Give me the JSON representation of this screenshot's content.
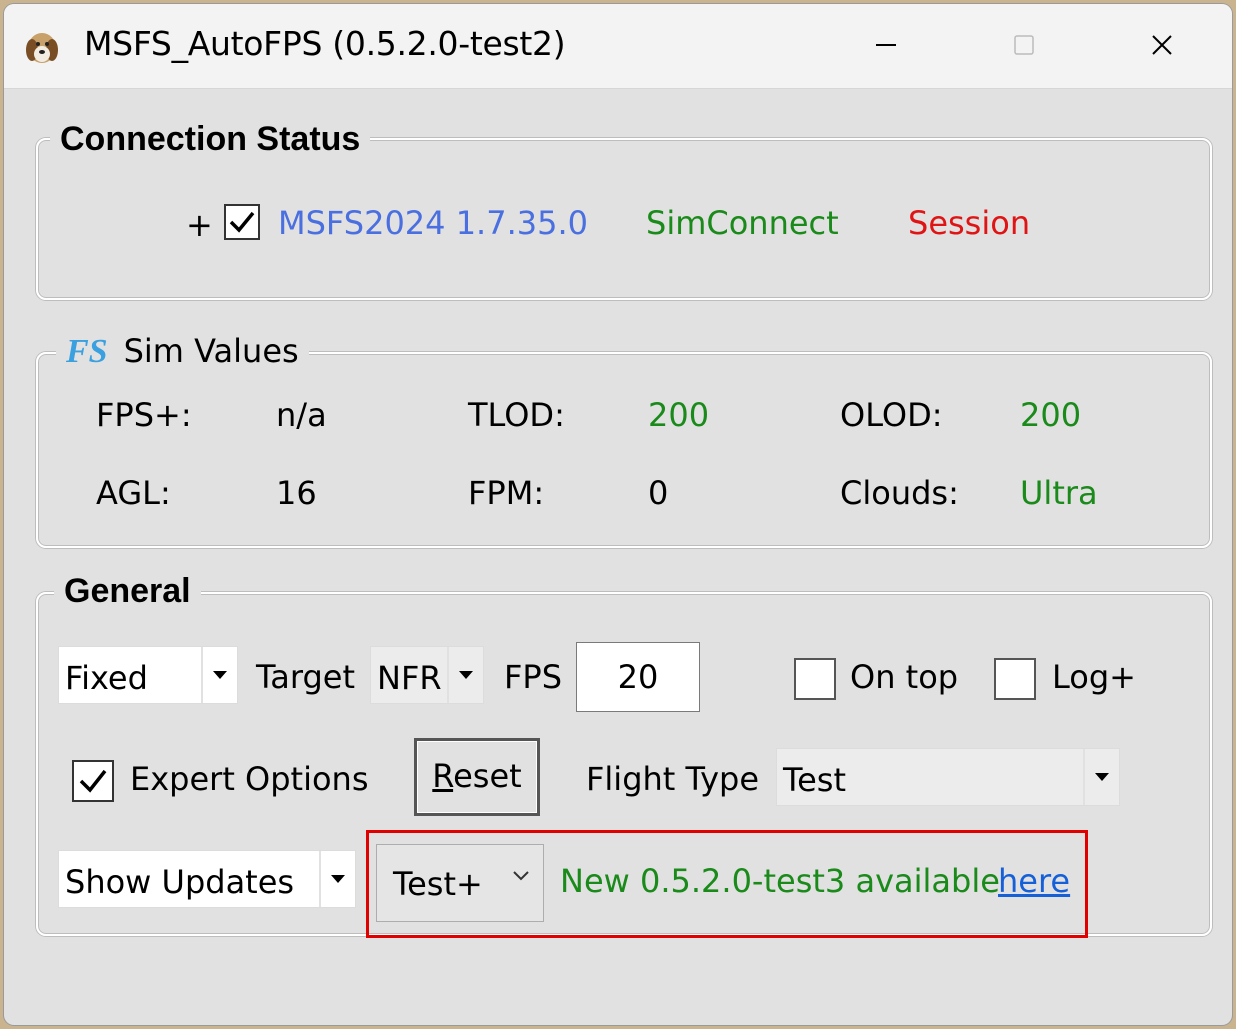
{
  "window": {
    "title": "MSFS_AutoFPS (0.5.2.0-test2)"
  },
  "connection": {
    "group_title": "Connection Status",
    "prefix": "+",
    "checked": true,
    "sim_version": "MSFS2024 1.7.35.0",
    "simconnect": "SimConnect",
    "session": "Session",
    "colors": {
      "sim": "#4a6fe0",
      "simconnect": "#1a8a1a",
      "session": "#e01414"
    }
  },
  "sim_values": {
    "group_title": "Sim Values",
    "icon_label": "FS",
    "fps_label": "FPS+:",
    "fps_value": "n/a",
    "tlod_label": "TLOD:",
    "tlod_value": "200",
    "olod_label": "OLOD:",
    "olod_value": "200",
    "agl_label": "AGL:",
    "agl_value": "16",
    "fpm_label": "FPM:",
    "fpm_value": "0",
    "clouds_label": "Clouds:",
    "clouds_value": "Ultra"
  },
  "general": {
    "group_title": "General",
    "mode_select": "Fixed",
    "target_label": "Target",
    "target_select": "NFR",
    "fps_label": "FPS",
    "fps_value": "20",
    "on_top_label": "On top",
    "on_top_checked": false,
    "log_label": "Log+",
    "log_checked": false,
    "expert_label": "Expert Options",
    "expert_checked": true,
    "reset_label_rest": "eset",
    "reset_label_accel": "R",
    "flight_type_label": "Flight Type",
    "flight_type_select": "Test",
    "show_updates_select": "Show Updates",
    "channel_select": "Test+",
    "update_message": "New 0.5.2.0-test3 available",
    "update_link": "here"
  }
}
